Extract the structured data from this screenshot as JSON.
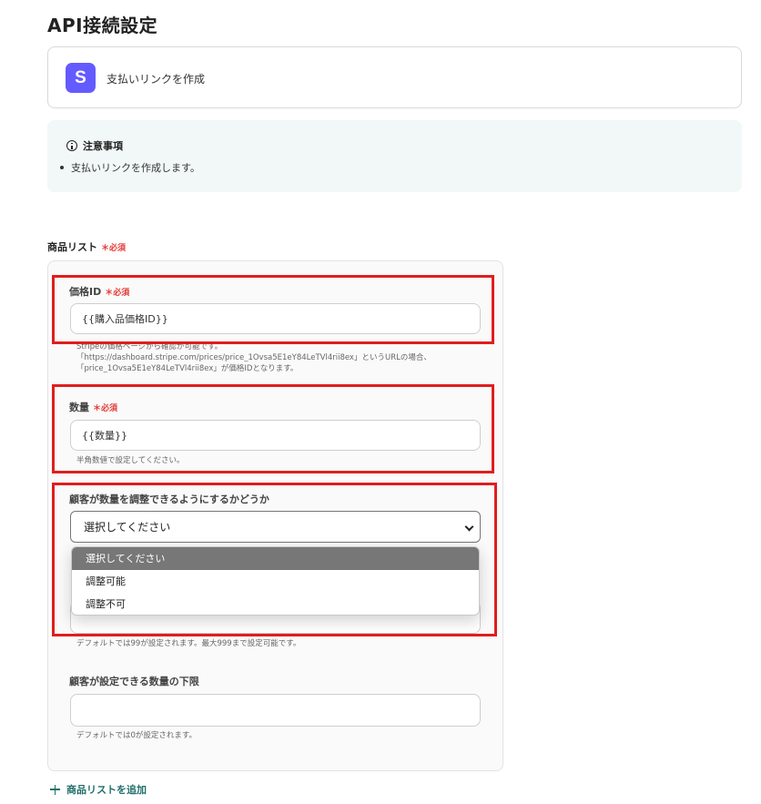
{
  "page": {
    "title": "API接続設定"
  },
  "action": {
    "icon_letter": "S",
    "label": "支払いリンクを作成",
    "icon_color": "#635bff"
  },
  "notice": {
    "title": "注意事項",
    "items": [
      "支払いリンクを作成します。"
    ]
  },
  "product_list": {
    "label": "商品リスト",
    "required_label": "＊必須",
    "fields": {
      "price_id": {
        "label": "価格ID",
        "required_label": "＊必須",
        "value": "{{購入品価格ID}}",
        "help": [
          "Stripeの価格ページから確認が可能です。",
          "「https://dashboard.stripe.com/prices/price_1Ovsa5E1eY84LeTVl4rii8ex」というURLの場合、",
          "「price_1Ovsa5E1eY84LeTVl4rii8ex」が価格IDとなります。"
        ]
      },
      "quantity": {
        "label": "数量",
        "required_label": "＊必須",
        "value": "{{数量}}",
        "help": "半角数値で設定してください。"
      },
      "adjustable": {
        "label": "顧客が数量を調整できるようにするかどうか",
        "selected": "選択してください",
        "options": [
          "選択してください",
          "調整可能",
          "調整不可"
        ]
      },
      "max_quantity": {
        "help": "デフォルトでは99が設定されます。最大999まで設定可能です。"
      },
      "min_quantity": {
        "label": "顧客が設定できる数量の下限",
        "value": "",
        "help": "デフォルトでは0が設定されます。"
      }
    }
  },
  "add_link": {
    "label": "商品リストを追加"
  },
  "colors": {
    "highlight": "#e01e1e",
    "accent": "#1f6f6a",
    "required": "#e53935"
  }
}
